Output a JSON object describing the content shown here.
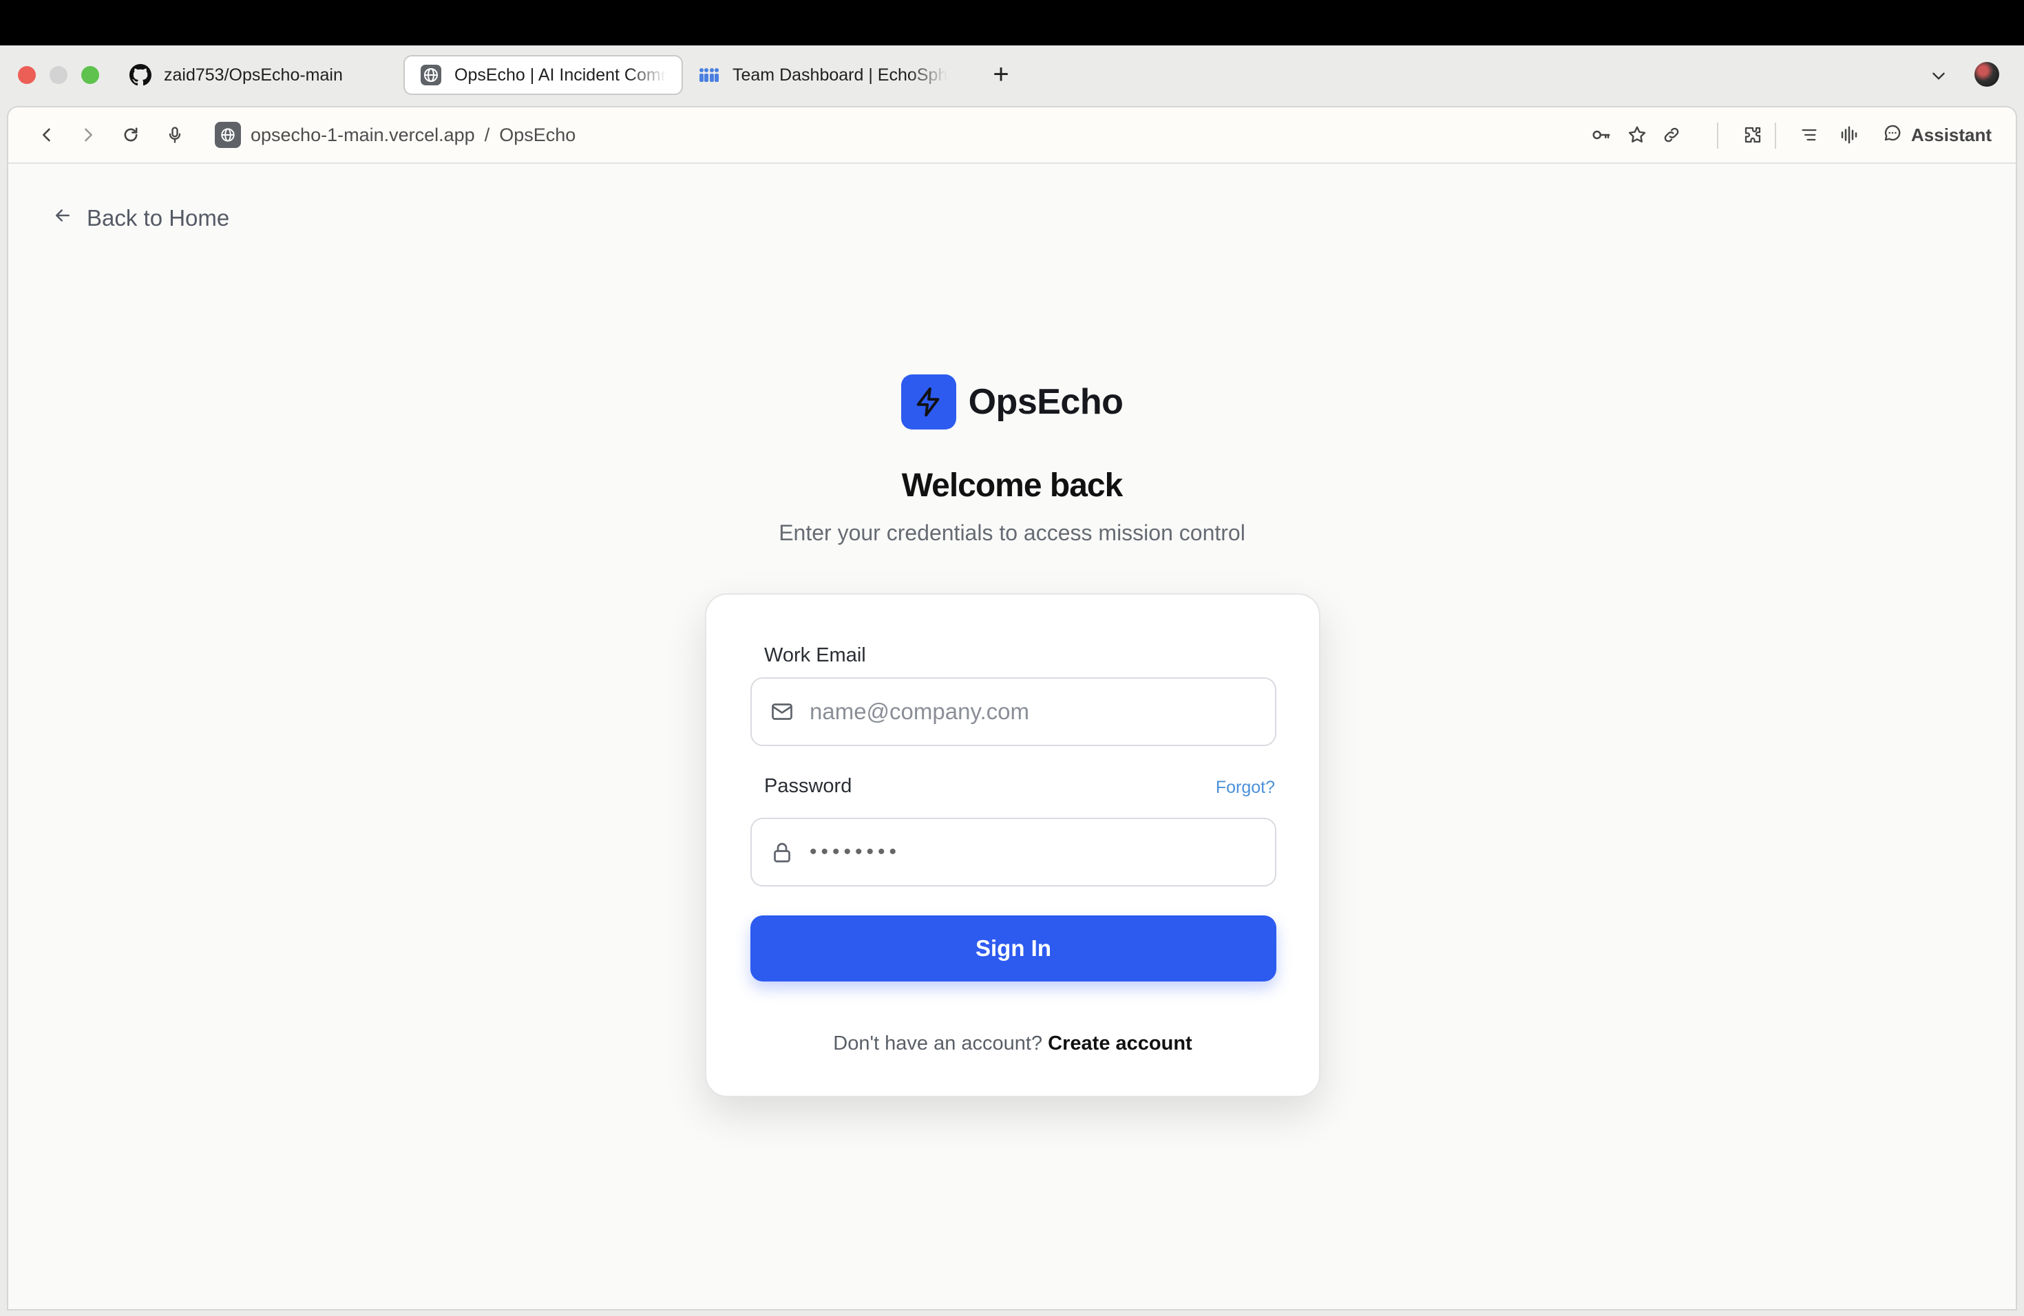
{
  "browser": {
    "tabs": [
      {
        "title": "zaid753/OpsEcho-main",
        "icon": "github-icon"
      },
      {
        "title": "OpsEcho | AI Incident Command",
        "icon": "globe-icon",
        "active": true
      },
      {
        "title": "Team Dashboard | EchoSphere",
        "icon": "team-icon"
      }
    ],
    "new_tab_label": "+",
    "url_domain": "opsecho-1-main.vercel.app",
    "url_separator": "/",
    "url_title": "OpsEcho",
    "assistant_label": "Assistant"
  },
  "page": {
    "back_label": "Back to Home",
    "brand_name": "OpsEcho",
    "heading": "Welcome back",
    "subtitle": "Enter your credentials to access mission control",
    "form": {
      "email_label": "Work Email",
      "email_placeholder": "name@company.com",
      "password_label": "Password",
      "forgot_label": "Forgot?",
      "password_mask": "••••••••",
      "submit_label": "Sign In",
      "no_account_text": "Don't have an account?",
      "create_account_label": "Create account"
    }
  },
  "colors": {
    "accent": "#2d5bf0",
    "link": "#4a90d9"
  }
}
